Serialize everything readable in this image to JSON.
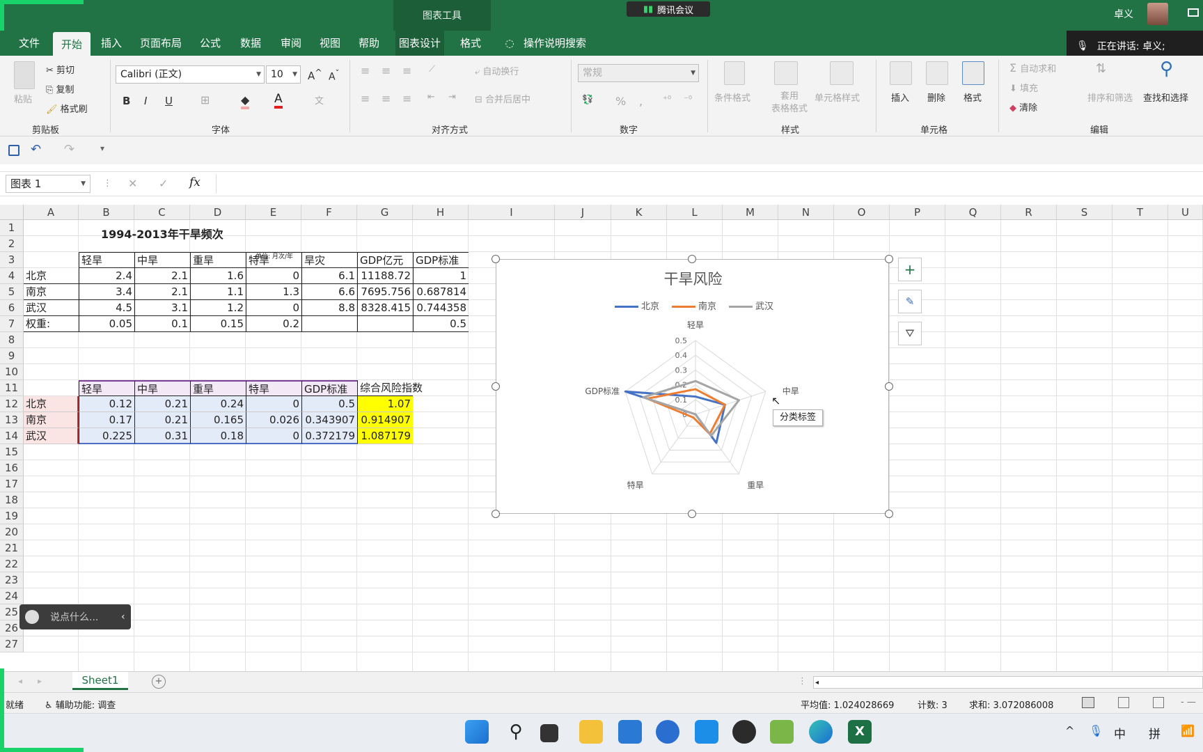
{
  "window": {
    "contextual_tab_group": "图表工具",
    "meeting_app": "腾讯会议",
    "username": "卓义",
    "speaking_text": "正在讲话: 卓义;"
  },
  "tabs": [
    "文件",
    "开始",
    "插入",
    "页面布局",
    "公式",
    "数据",
    "审阅",
    "视图",
    "帮助",
    "图表设计",
    "格式"
  ],
  "tell_me": "操作说明搜索",
  "ribbon": {
    "clipboard": {
      "paste": "粘贴",
      "cut": "剪切",
      "copy": "复制",
      "format_painter": "格式刷",
      "group": "剪贴板"
    },
    "font": {
      "name": "Calibri (正文)",
      "size": "10",
      "bold": "B",
      "italic": "I",
      "underline": "U",
      "group": "字体"
    },
    "alignment": {
      "wrap": "自动换行",
      "merge": "合并后居中",
      "group": "对齐方式"
    },
    "number": {
      "format": "常规",
      "percent": "%",
      "comma": ",",
      "group": "数字"
    },
    "styles": {
      "conditional": "条件格式",
      "table": "套用\n表格格式",
      "cell_styles": "单元格样式",
      "group": "样式"
    },
    "cells": {
      "insert": "插入",
      "delete": "删除",
      "format": "格式",
      "group": "单元格"
    },
    "editing": {
      "autosum": "自动求和",
      "fill": "填充",
      "clear": "清除",
      "sort": "排序和筛选",
      "find": "查找和选择",
      "group": "编辑"
    }
  },
  "name_box": "图表 1",
  "formula_bar": {
    "fx": "fx",
    "cancel": "✕",
    "enter": "✓",
    "value": ""
  },
  "columns": [
    "A",
    "B",
    "C",
    "D",
    "E",
    "F",
    "G",
    "H",
    "I",
    "J",
    "K",
    "L",
    "M",
    "N",
    "O",
    "P",
    "Q",
    "R",
    "S",
    "T",
    "U"
  ],
  "rows": [
    "1",
    "2",
    "3",
    "4",
    "5",
    "6",
    "7",
    "8",
    "9",
    "10",
    "11",
    "12",
    "13",
    "14",
    "15",
    "16",
    "17",
    "18",
    "19",
    "20",
    "21",
    "22",
    "23",
    "24",
    "25",
    "26",
    "27"
  ],
  "sheet": {
    "title": "1994-2013年干旱频次",
    "unit": "单位: 月次/年",
    "table1": {
      "headers": [
        "轻旱",
        "中旱",
        "重旱",
        "特旱",
        "旱灾",
        "GDP亿元",
        "GDP标准"
      ],
      "rows": [
        {
          "label": "北京",
          "values": [
            "2.4",
            "2.1",
            "1.6",
            "0",
            "6.1",
            "11188.72",
            "1"
          ]
        },
        {
          "label": "南京",
          "values": [
            "3.4",
            "2.1",
            "1.1",
            "1.3",
            "6.6",
            "7695.756",
            "0.687814"
          ]
        },
        {
          "label": "武汉",
          "values": [
            "4.5",
            "3.1",
            "1.2",
            "0",
            "8.8",
            "8328.415",
            "0.744358"
          ]
        }
      ],
      "weights": {
        "label": "权重:",
        "values": [
          "0.05",
          "0.1",
          "0.15",
          "0.2",
          "",
          "",
          "0.5"
        ]
      }
    },
    "table2": {
      "headers": [
        "轻旱",
        "中旱",
        "重旱",
        "特旱",
        "GDP标准",
        "综合风险指数"
      ],
      "rows": [
        {
          "label": "北京",
          "values": [
            "0.12",
            "0.21",
            "0.24",
            "0",
            "0.5",
            "1.07"
          ]
        },
        {
          "label": "南京",
          "values": [
            "0.17",
            "0.21",
            "0.165",
            "0.026",
            "0.343907",
            "0.914907"
          ]
        },
        {
          "label": "武汉",
          "values": [
            "0.225",
            "0.31",
            "0.18",
            "0",
            "0.372179",
            "1.087179"
          ]
        }
      ]
    }
  },
  "chart_data": {
    "type": "radar",
    "title": "干旱风险",
    "categories": [
      "轻旱",
      "中旱",
      "重旱",
      "特旱",
      "GDP标准"
    ],
    "series": [
      {
        "name": "北京",
        "values": [
          0.12,
          0.21,
          0.24,
          0,
          0.5
        ],
        "color": "#4472c4"
      },
      {
        "name": "南京",
        "values": [
          0.17,
          0.21,
          0.165,
          0.026,
          0.343907
        ],
        "color": "#ed7d31"
      },
      {
        "name": "武汉",
        "values": [
          0.225,
          0.31,
          0.18,
          0,
          0.372179
        ],
        "color": "#a5a5a5"
      }
    ],
    "r_ticks": [
      "0",
      "0.1",
      "0.2",
      "0.3",
      "0.4",
      "0.5"
    ],
    "r_max": 0.5,
    "legend_position": "top"
  },
  "chart_side_buttons": {
    "add": "+",
    "style": "brush",
    "filter": "filter"
  },
  "tooltip": "分类标签",
  "chat_widget": "说点什么...",
  "sheet_tab": "Sheet1",
  "status": {
    "ready": "就绪",
    "accessibility": "辅助功能: 调查",
    "average": "平均值: 1.024028669",
    "count": "计数: 3",
    "sum": "求和: 3.072086008"
  },
  "taskbar": {
    "ime1": "中",
    "ime2": "拼"
  }
}
